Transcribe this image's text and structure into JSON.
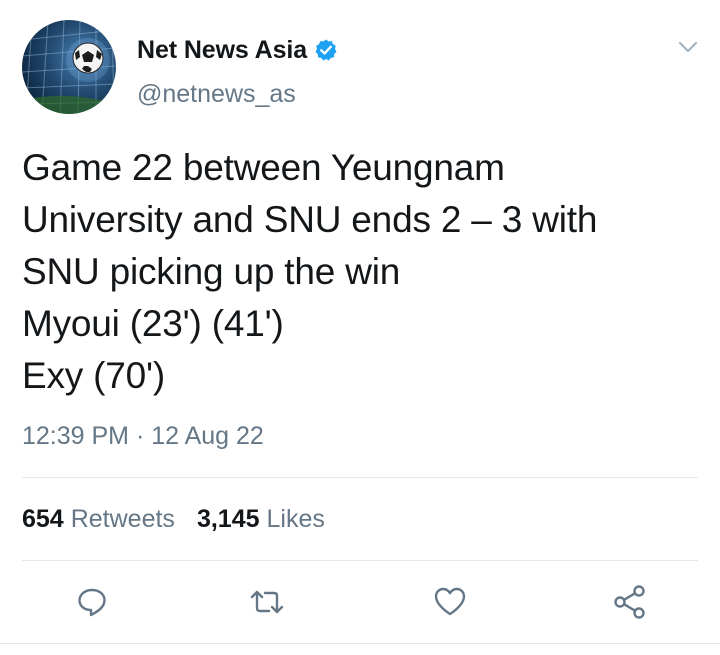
{
  "author": {
    "display_name": "Net News Asia",
    "handle": "@netnews_as",
    "verified": true,
    "avatar_icon": "soccer-ball-in-net-avatar"
  },
  "tweet": {
    "text": "Game 22 between Yeungnam\nUniversity and SNU ends 2 – 3 with\nSNU picking up the win\nMyoui (23') (41')\nExy (70')",
    "timestamp": "12:39 PM · 12 Aug 22"
  },
  "stats": {
    "retweets_count": "654",
    "retweets_label": "Retweets",
    "likes_count": "3,145",
    "likes_label": "Likes"
  },
  "actions": {
    "reply_icon": "reply-icon",
    "retweet_icon": "retweet-icon",
    "like_icon": "heart-icon",
    "share_icon": "share-icon"
  },
  "colors": {
    "text_primary": "#14171a",
    "text_secondary": "#657786",
    "verified_blue": "#1da1f2",
    "divider": "#e1e8ed"
  }
}
